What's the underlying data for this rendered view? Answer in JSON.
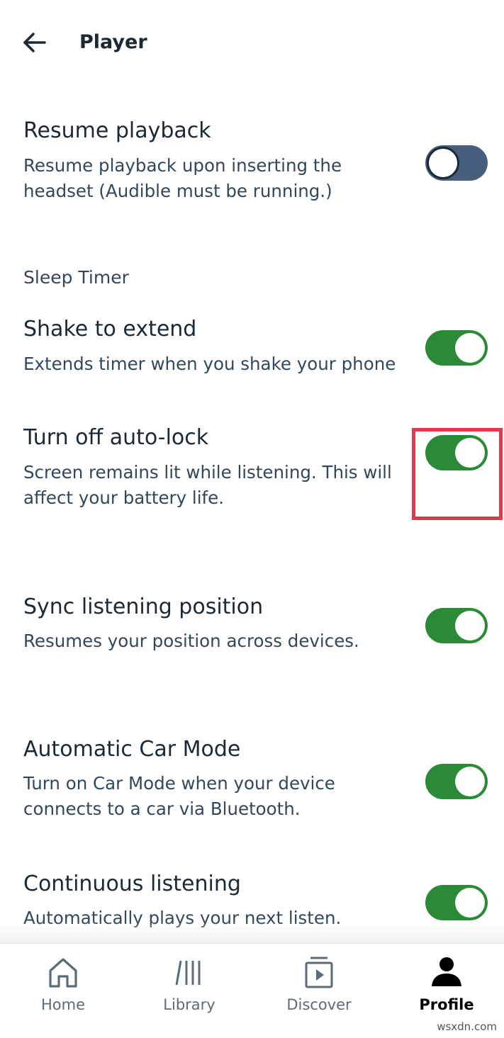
{
  "header": {
    "title": "Player",
    "back_icon": "arrow-left-icon"
  },
  "settings": {
    "resume_playback": {
      "title": "Resume playback",
      "description": "Resume playback upon inserting the headset (Audible must be running.)",
      "enabled": false
    },
    "sleep_timer_section": "Sleep Timer",
    "shake_to_extend": {
      "title": "Shake to extend",
      "description": "Extends timer when you shake your phone",
      "enabled": true
    },
    "auto_lock": {
      "title": "Turn off auto-lock",
      "description": "Screen remains lit while listening. This will affect your battery life.",
      "enabled": true
    },
    "sync_position": {
      "title": "Sync listening position",
      "description": "Resumes your position across devices.",
      "enabled": true
    },
    "car_mode": {
      "title": "Automatic Car Mode",
      "description": "Turn on Car Mode when your device connects to a car via Bluetooth.",
      "enabled": true
    },
    "continuous": {
      "title": "Continuous listening",
      "description": "Automatically plays your next listen.",
      "enabled": true
    }
  },
  "nav": {
    "items": [
      {
        "label": "Home",
        "icon": "home-icon",
        "active": false
      },
      {
        "label": "Library",
        "icon": "library-icon",
        "active": false
      },
      {
        "label": "Discover",
        "icon": "discover-icon",
        "active": false
      },
      {
        "label": "Profile",
        "icon": "profile-icon",
        "active": true
      }
    ]
  },
  "colors": {
    "toggle_on": "#2a8a36",
    "toggle_off": "#475f7d",
    "text_primary": "#1b2935",
    "text_secondary": "#33475a",
    "highlight": "#de3b4f"
  },
  "watermark": "wsxdn.com"
}
